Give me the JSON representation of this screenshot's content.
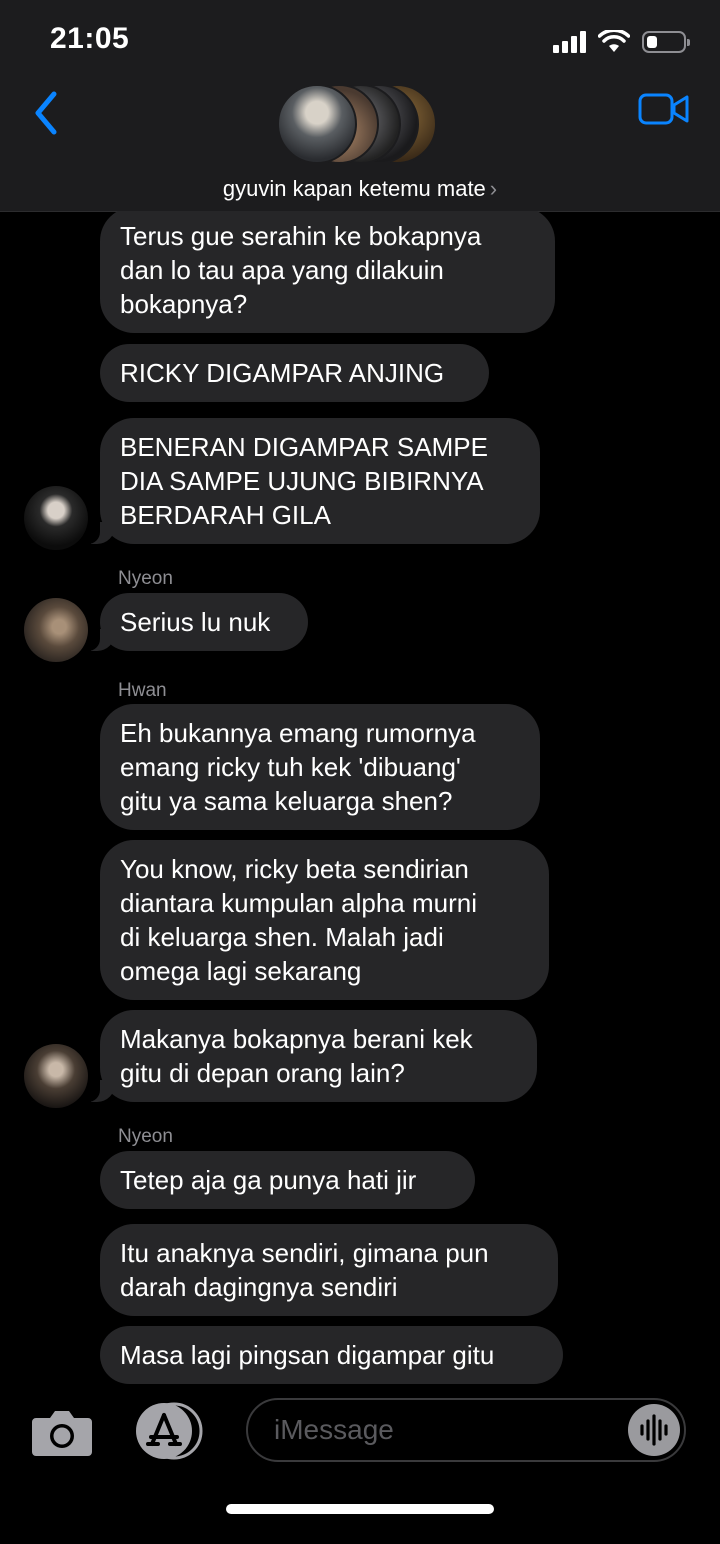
{
  "status_bar": {
    "time": "21:05",
    "battery_level": 0.3
  },
  "header": {
    "group_name": "gyuvin kapan ketemu mate",
    "group_chevron": "›",
    "back_icon": "chevron-left-icon",
    "video_icon": "video-camera-icon"
  },
  "messages": [
    {
      "text": [
        "Terus gue serahin ke bokapnya",
        "dan lo tau apa yang dilakuin",
        "bokapnya?"
      ]
    },
    {
      "text": [
        "RICKY DIGAMPAR ANJING"
      ]
    },
    {
      "text": [
        "BENERAN DIGAMPAR SAMPE",
        "DIA SAMPE UJUNG BIBIRNYA",
        "BERDARAH GILA"
      ]
    },
    {
      "sender": "Nyeon",
      "text": [
        "Serius lu nuk"
      ]
    },
    {
      "sender": "Hwan",
      "text": [
        "Eh bukannya emang rumornya",
        "emang ricky tuh kek 'dibuang'",
        "gitu ya sama keluarga shen?"
      ]
    },
    {
      "text": [
        "You know, ricky beta sendirian",
        "diantara kumpulan alpha murni",
        "di keluarga shen. Malah jadi",
        "omega lagi sekarang"
      ]
    },
    {
      "text": [
        "Makanya bokapnya berani kek",
        "gitu di depan orang lain?"
      ]
    },
    {
      "sender": "Nyeon",
      "text": [
        "Tetep aja ga punya hati jir"
      ]
    },
    {
      "text": [
        "Itu anaknya sendiri, gimana pun",
        "darah dagingnya sendiri"
      ]
    },
    {
      "text": [
        "Masa lagi pingsan digampar gitu"
      ]
    }
  ],
  "input_bar": {
    "placeholder": "iMessage",
    "camera_icon": "camera-icon",
    "appstore_icon": "app-store-icon",
    "audio_icon": "audio-waveform-icon"
  },
  "colors": {
    "accent": "#0a84ff",
    "bubble": "#262628",
    "header_bg": "#1c1c1e",
    "secondary_text": "#8e8e93"
  }
}
